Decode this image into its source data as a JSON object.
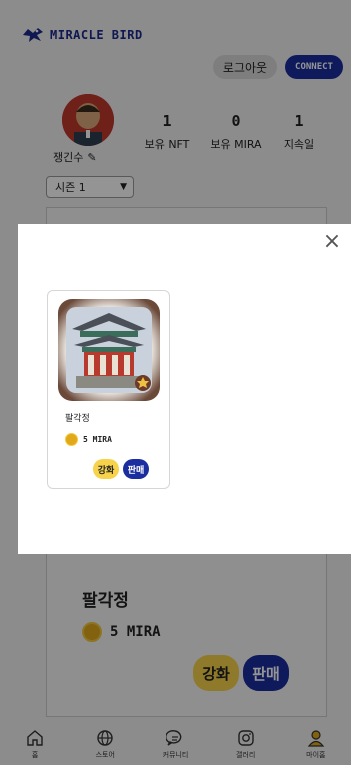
{
  "header": {
    "logo_text": "MIRACLE BIRD",
    "logout_label": "로그아웃",
    "connect_label": "CONNECT"
  },
  "profile": {
    "username": "쟁긴수",
    "stats": [
      {
        "value": "1",
        "label": "보유 NFT"
      },
      {
        "value": "0",
        "label": "보유 MIRA"
      },
      {
        "value": "1",
        "label": "지속일"
      }
    ]
  },
  "season": {
    "selected": "시즌 1"
  },
  "background_card": {
    "name": "팔각정",
    "price": "5 MIRA",
    "upgrade_label": "강화",
    "sell_label": "판매"
  },
  "modal": {
    "close_label": "×",
    "card": {
      "name": "팔각정",
      "price": "5 MIRA",
      "upgrade_label": "강화",
      "sell_label": "판매"
    }
  },
  "bottom_nav": [
    {
      "label": "홈",
      "icon": "home-icon"
    },
    {
      "label": "스토어",
      "icon": "globe-icon"
    },
    {
      "label": "커뮤니티",
      "icon": "chat-icon"
    },
    {
      "label": "갤러리",
      "icon": "instagram-icon"
    },
    {
      "label": "마이홈",
      "icon": "user-icon"
    }
  ],
  "colors": {
    "primary_blue": "#1a2ea0",
    "upgrade_yellow": "#f6d34a",
    "coin_gold": "#e1a91a"
  }
}
